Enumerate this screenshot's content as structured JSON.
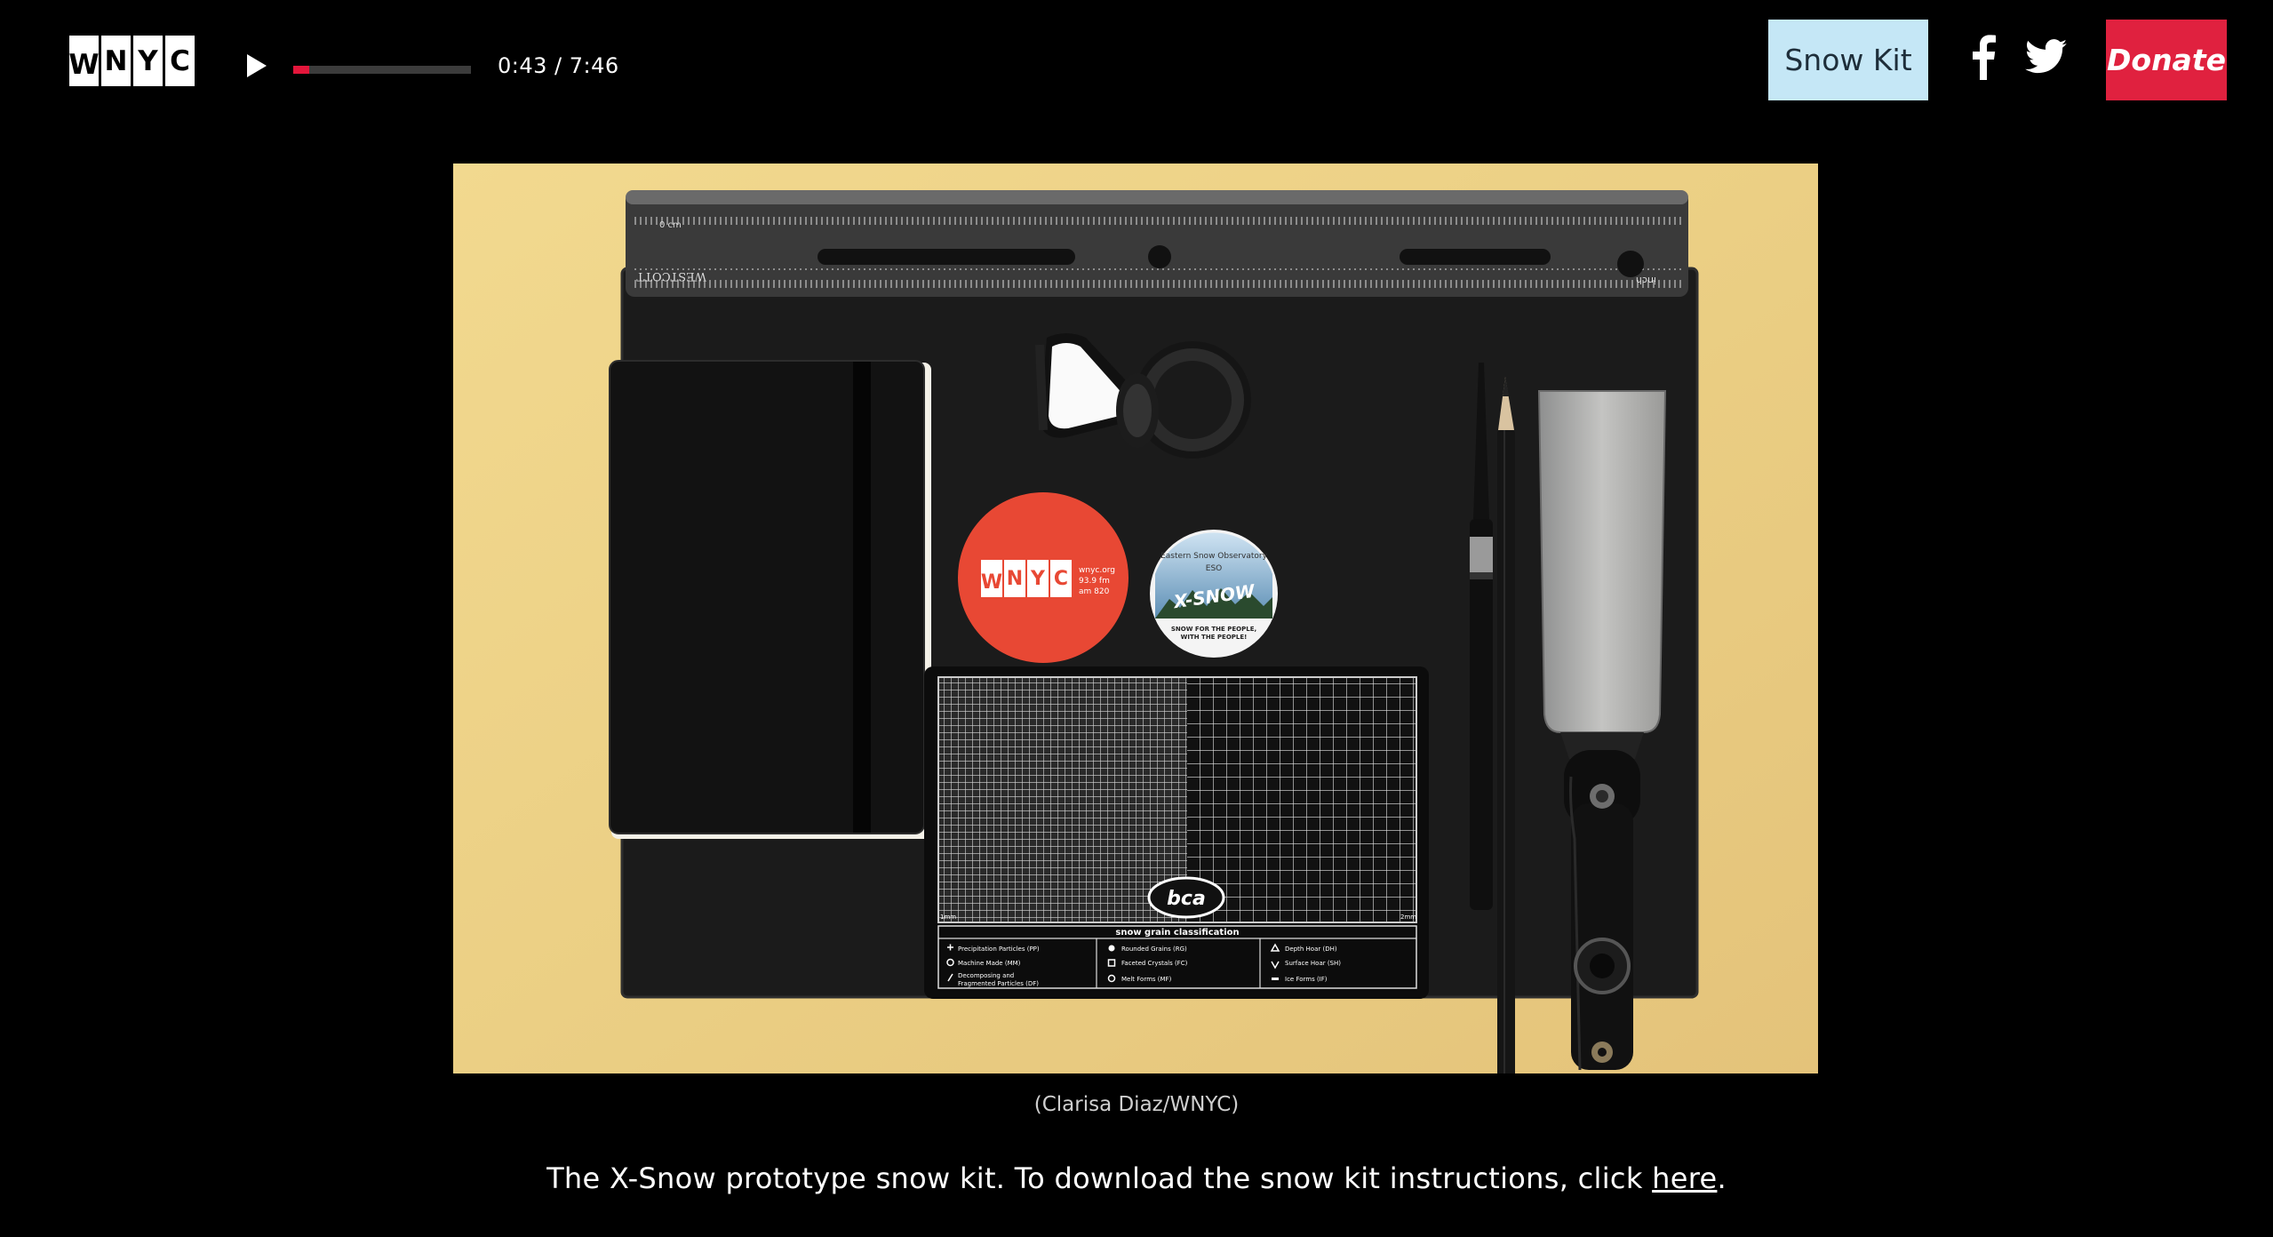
{
  "header": {
    "logo_letters": [
      "W",
      "N",
      "Y",
      "C"
    ],
    "player": {
      "play_icon": "play-icon",
      "progress_fraction": 0.09,
      "progress_color": "#e3163b",
      "time_label": "0:43 / 7:46"
    },
    "snow_kit_label": "Snow Kit",
    "social": {
      "facebook_icon": "facebook-icon",
      "twitter_icon": "twitter-icon"
    },
    "donate_label": "Donate"
  },
  "figure": {
    "ruler_top_label": "0 cm",
    "ruler_brand": "WESTCOTT",
    "ruler_unit": "inch",
    "sticker_wnyc": {
      "letters": [
        "W",
        "N",
        "Y",
        "C"
      ],
      "lines": [
        "wnyc.org",
        "93.9 fm",
        "am 820"
      ]
    },
    "sticker_xsnow": {
      "arc_text": "Eastern Snow Observatory",
      "code": "ESO",
      "title": "X-SNOW",
      "lines": [
        "SNOW FOR THE PEOPLE,",
        "WITH THE PEOPLE!"
      ]
    },
    "card": {
      "brand": "bca",
      "heading": "snow grain classification",
      "col1": [
        "Precipitation Particles (PP)",
        "Machine Made (MM)",
        "Decomposing and",
        "Fragmented Particles (DF)"
      ],
      "col2": [
        "Rounded Grains (RG)",
        "Faceted Crystals (FC)",
        "Melt Forms (MF)"
      ],
      "col3": [
        "Depth Hoar (DH)",
        "Surface Hoar (SH)",
        "Ice Forms (IF)"
      ],
      "scale_left": "1mm",
      "scale_right": "2mm"
    },
    "credit": "(Clarisa Diaz/WNYC)",
    "caption_text": "The X-Snow prototype snow kit. To download the snow kit instructions, click ",
    "caption_link": "here",
    "caption_end": "."
  },
  "colors": {
    "accent_red": "#e0213f",
    "snow_kit_bg": "#c5e7f6",
    "background": "#000000"
  }
}
